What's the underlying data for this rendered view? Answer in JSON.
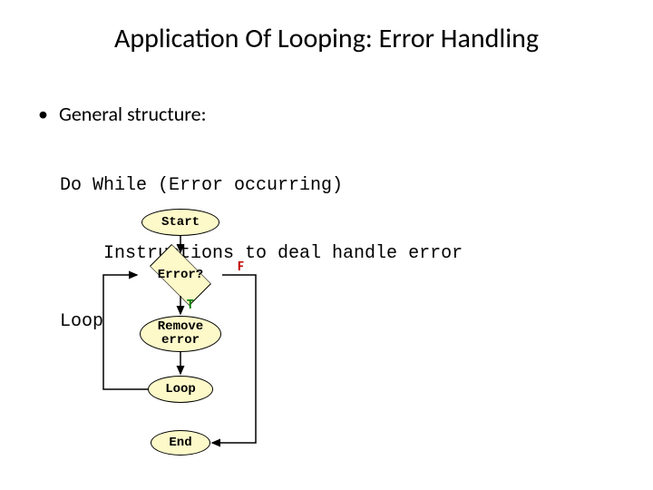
{
  "title": "Application Of Looping: Error Handling",
  "bullet": "General structure:",
  "code": {
    "line1": "Do While (Error occurring)",
    "line2": "    Instructions to deal handle error",
    "line3": "Loop"
  },
  "flow": {
    "start": "Start",
    "decision": "Error?",
    "true_label": "T",
    "false_label": "F",
    "process": "Remove\nerror",
    "loop": "Loop",
    "end": "End"
  }
}
